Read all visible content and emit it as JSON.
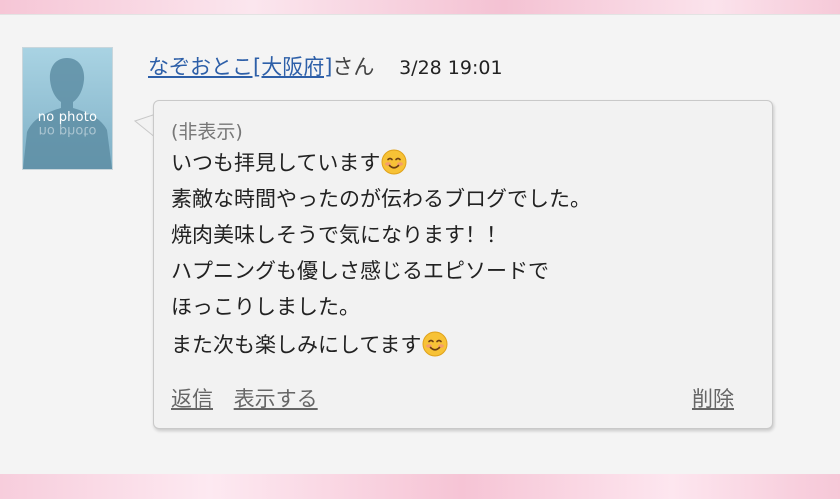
{
  "comment": {
    "author": "なぞおとこ[大阪府]",
    "honorific": "さん",
    "timestamp": "3/28 19:01",
    "avatar_text": "no photo",
    "hidden_label": "(非表示)",
    "lines": [
      "いつも拝見しています",
      "素敵な時間やったのが伝わるブログでした。",
      "焼肉美味しそうで気になります！！",
      "ハプニングも優しさ感じるエピソードで",
      "ほっこりしました。",
      "また次も楽しみにしてます"
    ],
    "emoji": "smiling-face-emoji",
    "actions": {
      "reply": "返信",
      "show": "表示する",
      "delete": "削除"
    }
  },
  "colors": {
    "link": "#2d5fa8",
    "action": "#666666",
    "panel": "#f4f4f4",
    "pink_frame": "#f7d9e3"
  }
}
